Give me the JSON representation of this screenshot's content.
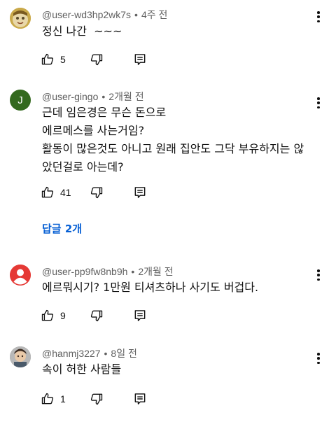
{
  "comments": [
    {
      "author": "@user-wd3hp2wk7s",
      "time": "4주 전",
      "text": "정신 나간  ~~~",
      "likes": "5",
      "avatar": {
        "type": "photo",
        "color": "#d8b24a"
      }
    },
    {
      "author": "@user-gingo",
      "time": "2개월 전",
      "text": "근데 임은경은 무슨 돈으로\n에르메스를 사는거임?\n활동이 많은것도 아니고 원래 집안도 그닥 부유하지는 않\n았던걸로 아는데?",
      "likes": "41",
      "avatar": {
        "type": "initial",
        "letter": "J",
        "color": "#33691e"
      },
      "replies_label": "답글 2개"
    },
    {
      "author": "@user-pp9fw8nb9h",
      "time": "2개월 전",
      "text": "에르뭐시기? 1만원 티셔츠하나 사기도 버겁다.",
      "likes": "9",
      "avatar": {
        "type": "default",
        "color": "#e53935"
      }
    },
    {
      "author": "@hanmj3227",
      "time": "8일 전",
      "text": "속이 허한 사람들",
      "likes": "1",
      "avatar": {
        "type": "photo",
        "color": "#8d8d8d"
      }
    }
  ],
  "colors": {
    "link": "#065fd4",
    "meta": "#606060",
    "text": "#0f0f0f"
  },
  "icons": [
    "thumb-up-icon",
    "thumb-down-icon",
    "reply-icon",
    "more-vert-icon"
  ]
}
